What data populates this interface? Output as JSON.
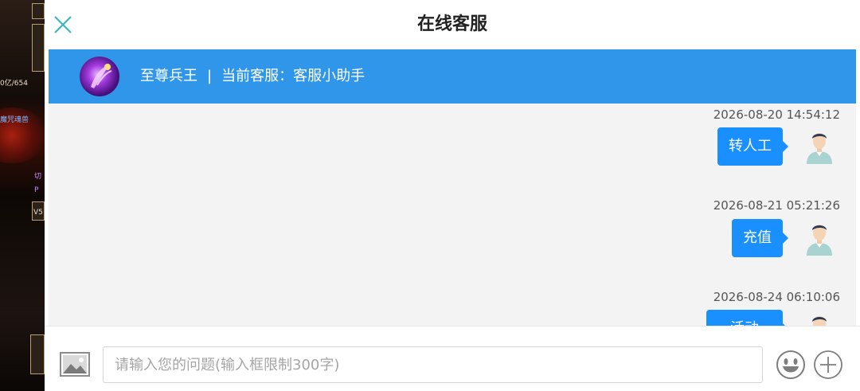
{
  "header": {
    "title": "在线客服"
  },
  "info_bar": {
    "server": "至尊兵王",
    "separator": "|",
    "agent": "当前客服：客服小助手"
  },
  "messages": [
    {
      "time": "2026-08-20 14:54:12",
      "text": "转人工"
    },
    {
      "time": "2026-08-21 05:21:26",
      "text": "充值"
    },
    {
      "time": "2026-08-24 06:10:06",
      "text": "活动"
    }
  ],
  "composer": {
    "placeholder": "请输入您的问题(输入框限制300字)",
    "value": ""
  },
  "game_background": {
    "power": "0亿/654",
    "label": "魔咒魂兽",
    "level": "V5",
    "letters": [
      "切",
      "P"
    ]
  },
  "colors": {
    "accent": "#2f96ea",
    "bubble": "#1a8fff",
    "close": "#3ab7c4"
  },
  "icons": [
    "close-icon",
    "image-upload-icon",
    "emoji-icon",
    "plus-icon",
    "customer-avatar-icon",
    "game-logo-icon"
  ]
}
